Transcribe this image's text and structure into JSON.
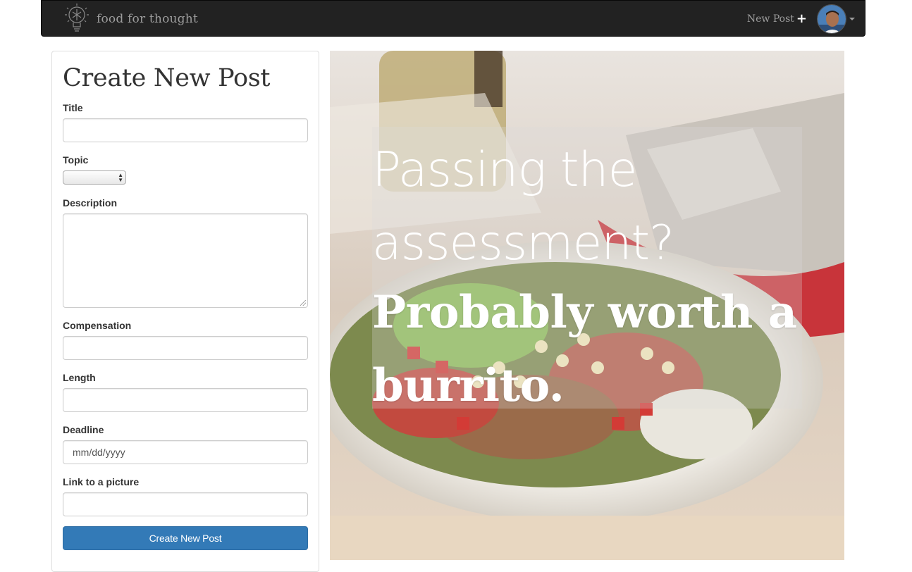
{
  "navbar": {
    "brand": "food for thought",
    "new_post_label": "New Post",
    "plus_glyph": "+"
  },
  "form": {
    "title": "Create New Post",
    "fields": {
      "title_label": "Title",
      "topic_label": "Topic",
      "description_label": "Description",
      "compensation_label": "Compensation",
      "length_label": "Length",
      "deadline_label": "Deadline",
      "deadline_placeholder": "mm/dd/yyyy",
      "picture_label": "Link to a picture"
    },
    "submit_label": "Create New Post"
  },
  "hero": {
    "line1": "Passing the assessment?",
    "line2": "Probably worth a burrito."
  },
  "colors": {
    "navbar_bg": "#222222",
    "navbar_text": "#9d9d9d",
    "primary_button": "#337ab7"
  },
  "icons": [
    "lightbulb-logo-icon",
    "plus-icon",
    "avatar",
    "caret-down-icon",
    "select-arrows-icon"
  ]
}
